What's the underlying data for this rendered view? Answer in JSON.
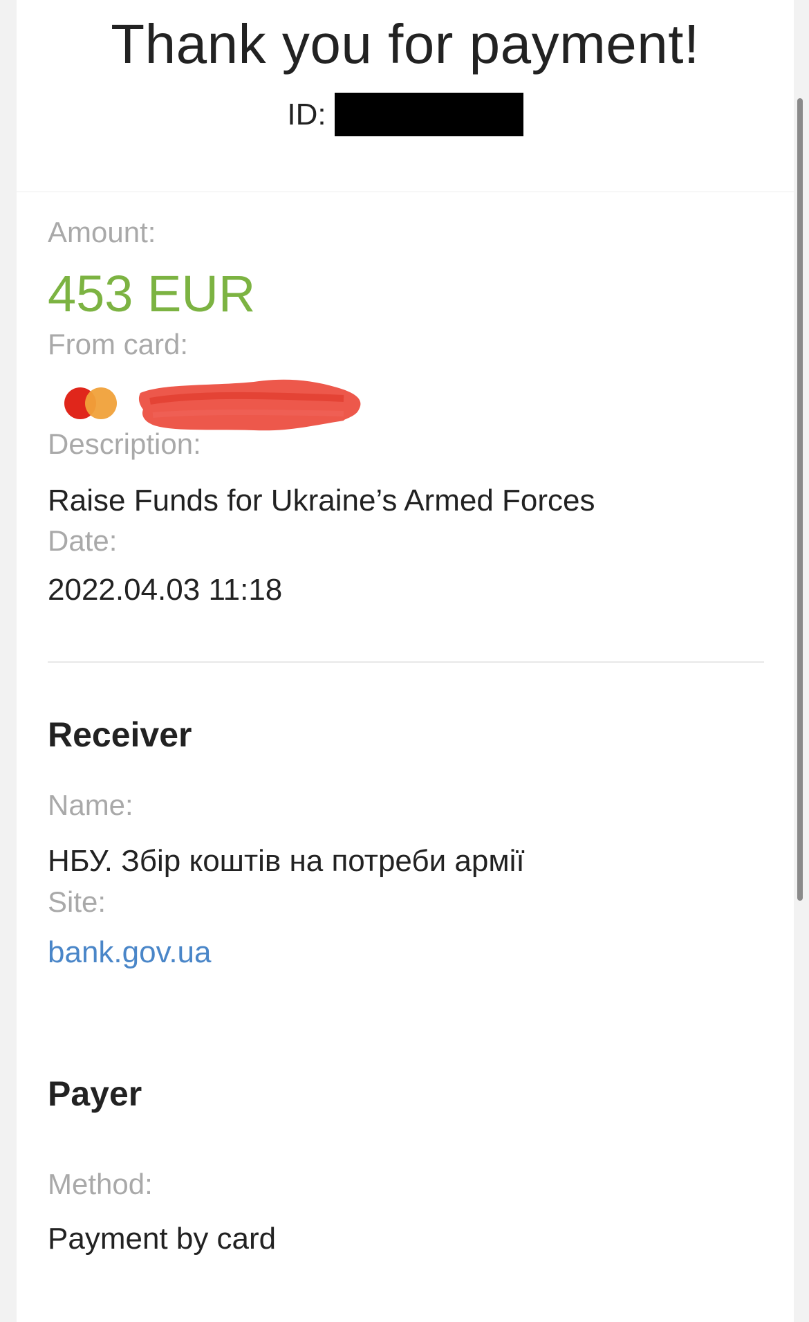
{
  "header": {
    "title": "Thank you for payment!",
    "id_label": "ID:"
  },
  "payment": {
    "amount_label": "Amount:",
    "amount_value": "453 EUR",
    "card_label": "From card:",
    "card_brand_icon": "mastercard-icon",
    "description_label": "Description:",
    "description_value": "Raise Funds for Ukraine’s Armed Forces",
    "date_label": "Date:",
    "date_value": "2022.04.03 11:18"
  },
  "receiver": {
    "title": "Receiver",
    "name_label": "Name:",
    "name_value": "НБУ. Збір коштів на потреби армії",
    "site_label": "Site:",
    "site_value": "bank.gov.ua"
  },
  "payer": {
    "title": "Payer",
    "method_label": "Method:",
    "method_value": "Payment by card"
  },
  "colors": {
    "amount": "#7cb342",
    "link": "#4a86c8",
    "label": "#a9a9a9",
    "text": "#222222",
    "redaction_black": "#000000",
    "redaction_red": "#ec4a3c"
  }
}
